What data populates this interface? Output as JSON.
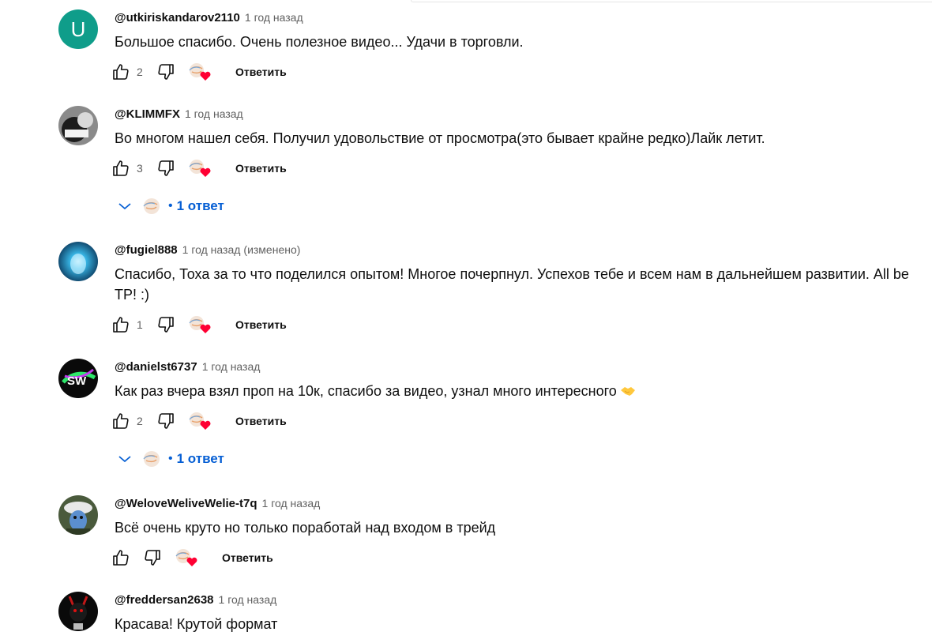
{
  "comments": [
    {
      "author": "@utkiriskandarov2110",
      "time": "1 год назад",
      "edited": "",
      "text": "Большое спасибо. Очень полезное видео... Удачи в торговли.",
      "likes": "2",
      "reply_label": "Ответить",
      "avatar_letter": "U",
      "avatar_color": "#0f9d8a"
    },
    {
      "author": "@KLIMMFX",
      "time": "1 год назад",
      "edited": "",
      "text": "Во многом нашел себя. Получил удовольствие от просмотра(это бывает крайне редко)Лайк летит.",
      "likes": "3",
      "reply_label": "Ответить",
      "replies_label": "1 ответ"
    },
    {
      "author": "@fugiel888",
      "time": "1 год назад",
      "edited": "(изменено)",
      "text": "Спасибо, Тоха за то что поделился опытом! Многое почерпнул. Успехов тебе и всем нам в дальнейшем развитии. All be TP! :)",
      "likes": "1",
      "reply_label": "Ответить"
    },
    {
      "author": "@danielst6737",
      "time": "1 год назад",
      "edited": "",
      "text": "Как раз вчера взял проп на 10к, спасибо за видео, узнал много интересного",
      "likes": "2",
      "reply_label": "Ответить",
      "replies_label": "1 ответ"
    },
    {
      "author": "@WeloveWeliveWelie-t7q",
      "time": "1 год назад",
      "edited": "",
      "text": "Всё очень круто но только поработай над входом в трейд",
      "likes": "",
      "reply_label": "Ответить"
    },
    {
      "author": "@freddersan2638",
      "time": "1 год назад",
      "edited": "",
      "text": "Красава! Крутой формат"
    }
  ],
  "colors": {
    "link_blue": "#065fd4",
    "heart_red": "#ff0033",
    "meta_gray": "#606060"
  },
  "icons": [
    "thumb-up-icon",
    "thumb-down-icon",
    "creator-heart-icon",
    "chevron-down-icon",
    "handshake-emoji-icon"
  ]
}
